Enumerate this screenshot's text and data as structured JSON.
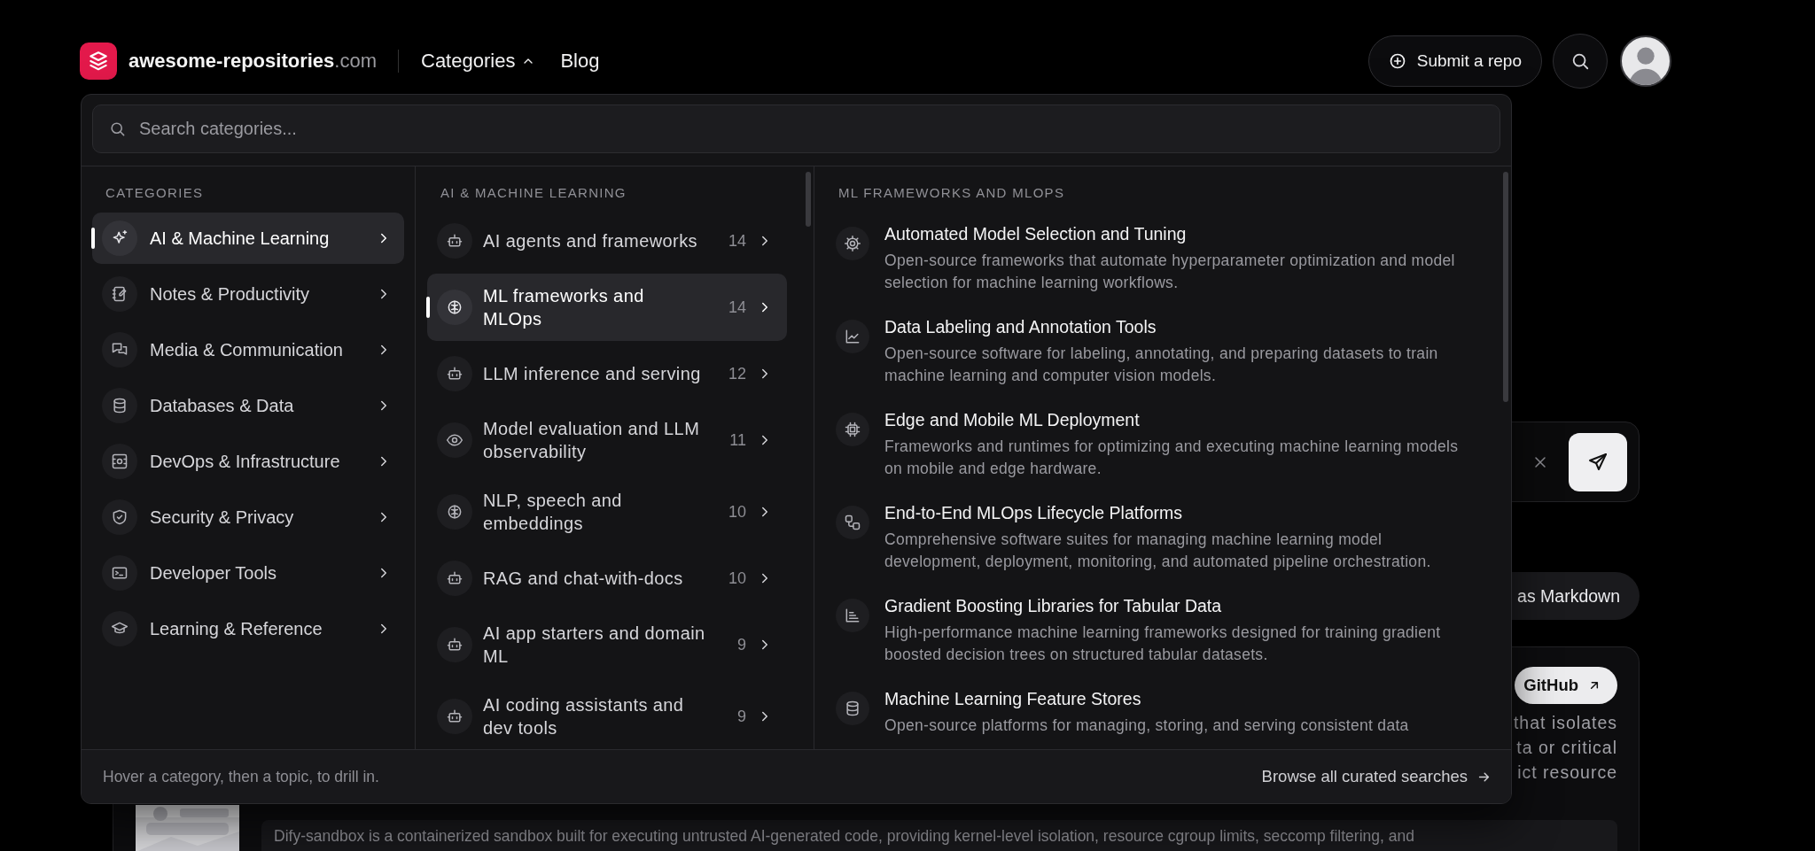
{
  "header": {
    "brand": "awesome-repositories",
    "brand_suffix": ".com",
    "categories_menu": {
      "label": "Categories",
      "expanded": true
    },
    "blog_link": "Blog",
    "submit_button": "Submit a repo"
  },
  "menu": {
    "search": {
      "placeholder": "Search categories..."
    },
    "categories": {
      "heading": "CATEGORIES",
      "items": [
        {
          "label": "AI & Machine Learning",
          "selected": true
        },
        {
          "label": "Notes & Productivity",
          "selected": false
        },
        {
          "label": "Media & Communication",
          "selected": false
        },
        {
          "label": "Databases & Data",
          "selected": false
        },
        {
          "label": "DevOps & Infrastructure",
          "selected": false
        },
        {
          "label": "Security & Privacy",
          "selected": false
        },
        {
          "label": "Developer Tools",
          "selected": false
        },
        {
          "label": "Learning & Reference",
          "selected": false
        }
      ]
    },
    "topics": {
      "heading": "AI & MACHINE LEARNING",
      "items": [
        {
          "label": "AI agents and frameworks",
          "count": "14",
          "selected": false
        },
        {
          "label": "ML frameworks and MLOps",
          "count": "14",
          "selected": true
        },
        {
          "label": "LLM inference and serving",
          "count": "12",
          "selected": false
        },
        {
          "label": "Model evaluation and LLM observability",
          "count": "11",
          "selected": false
        },
        {
          "label": "NLP, speech and embeddings",
          "count": "10",
          "selected": false
        },
        {
          "label": "RAG and chat-with-docs",
          "count": "10",
          "selected": false
        },
        {
          "label": "AI app starters and domain ML",
          "count": "9",
          "selected": false
        },
        {
          "label": "AI coding assistants and dev tools",
          "count": "9",
          "selected": false
        }
      ]
    },
    "subtopics": {
      "heading": "ML FRAMEWORKS AND MLOPS",
      "items": [
        {
          "title": "Automated Model Selection and Tuning",
          "description": "Open-source frameworks that automate hyperparameter optimization and model selection for machine learning workflows."
        },
        {
          "title": "Data Labeling and Annotation Tools",
          "description": "Open-source software for labeling, annotating, and preparing datasets to train machine learning and computer vision models."
        },
        {
          "title": "Edge and Mobile ML Deployment",
          "description": "Frameworks and runtimes for optimizing and executing machine learning models on mobile and edge hardware."
        },
        {
          "title": "End-to-End MLOps Lifecycle Platforms",
          "description": "Comprehensive software suites for managing machine learning model development, deployment, monitoring, and automated pipeline orchestration."
        },
        {
          "title": "Gradient Boosting Libraries for Tabular Data",
          "description": "High-performance machine learning frameworks designed for training gradient boosted decision trees on structured tabular datasets."
        },
        {
          "title": "Machine Learning Feature Stores",
          "description": "Open-source platforms for managing, storing, and serving consistent data"
        }
      ]
    },
    "footer": {
      "hint": "Hover a category, then a topic, to drill in.",
      "link": "Browse all curated searches"
    }
  },
  "page": {
    "export_button": "as Markdown",
    "github_button": "GitHub",
    "description_fragments": [
      "that isolates",
      "ta or critical",
      "ict resource"
    ],
    "summary": "Dify-sandbox is a containerized sandbox built for executing untrusted AI-generated code, providing kernel-level isolation, resource cgroup limits, seccomp filtering, and"
  }
}
